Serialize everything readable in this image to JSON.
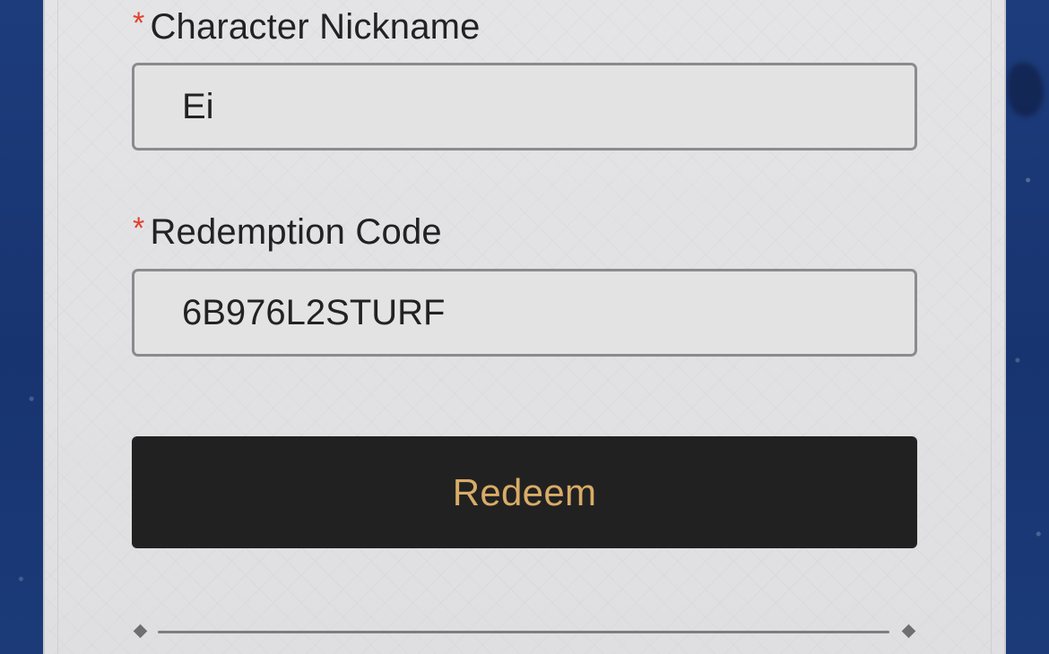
{
  "form": {
    "nickname": {
      "required_mark": "*",
      "label": "Character Nickname",
      "value": "Ei"
    },
    "code": {
      "required_mark": "*",
      "label": "Redemption Code",
      "value": "6B976L2STURF"
    },
    "submit_label": "Redeem"
  },
  "colors": {
    "background": "#1c3a78",
    "panel": "#e2e2e4",
    "required": "#e0402e",
    "button_bg": "#222122",
    "button_text": "#d8ac66"
  }
}
